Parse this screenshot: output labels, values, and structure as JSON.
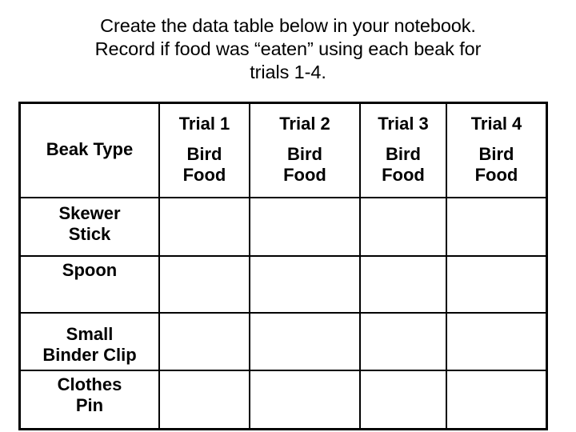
{
  "title": {
    "line1": "Create the data table below in your notebook.",
    "line2": "Record if food was “eaten” using each beak for",
    "line3": "trials 1-4."
  },
  "table": {
    "columns": [
      {
        "id": "beak-type",
        "label": "Beak Type",
        "sub": ""
      },
      {
        "id": "trial-1",
        "label": "Trial 1",
        "sub_line1": "Bird",
        "sub_line2": "Food"
      },
      {
        "id": "trial-2",
        "label": "Trial 2",
        "sub_line1": "Bird",
        "sub_line2": "Food"
      },
      {
        "id": "trial-3",
        "label": "Trial 3",
        "sub_line1": "Bird",
        "sub_line2": "Food"
      },
      {
        "id": "trial-4",
        "label": "Trial 4",
        "sub_line1": "Bird",
        "sub_line2": "Food"
      }
    ],
    "rows": [
      {
        "id": "skewer-stick",
        "label_line1": "Skewer",
        "label_line2": "Stick",
        "trial_1": "",
        "trial_2": "",
        "trial_3": "",
        "trial_4": ""
      },
      {
        "id": "spoon",
        "label_line1": "Spoon",
        "label_line2": "",
        "trial_1": "",
        "trial_2": "",
        "trial_3": "",
        "trial_4": ""
      },
      {
        "id": "small-binder-clip",
        "label_line1": "Small",
        "label_line2": "Binder Clip",
        "trial_1": "",
        "trial_2": "",
        "trial_3": "",
        "trial_4": ""
      },
      {
        "id": "clothes-pin",
        "label_line1": "Clothes",
        "label_line2": "Pin",
        "trial_1": "",
        "trial_2": "",
        "trial_3": "",
        "trial_4": ""
      }
    ]
  },
  "colors": {
    "background": "#ffffff",
    "text": "#000000",
    "border": "#000000"
  }
}
